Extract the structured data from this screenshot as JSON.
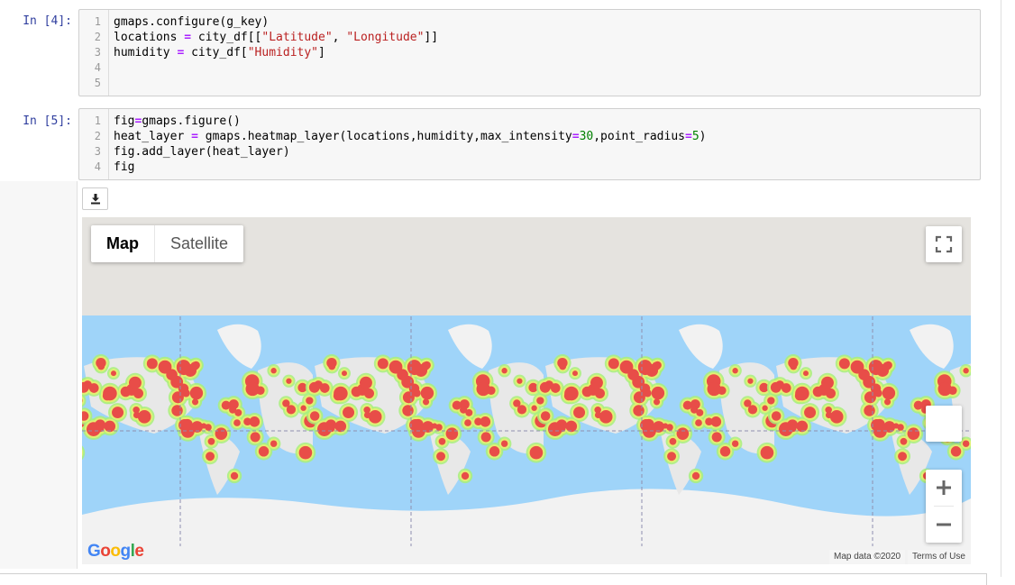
{
  "cells": [
    {
      "prompt": "In [4]:",
      "lines": [
        {
          "n": "1",
          "parts": [
            [
              "gmaps.configure(g_key)",
              ""
            ]
          ]
        },
        {
          "n": "2",
          "parts": [
            [
              "locations ",
              ""
            ],
            [
              "=",
              "op"
            ],
            [
              " city_df[[",
              ""
            ],
            [
              "\"Latitude\"",
              "str"
            ],
            [
              ", ",
              ""
            ],
            [
              "\"Longitude\"",
              "str"
            ],
            [
              "]]",
              ""
            ]
          ]
        },
        {
          "n": "3",
          "parts": [
            [
              "humidity ",
              ""
            ],
            [
              "=",
              "op"
            ],
            [
              " city_df[",
              ""
            ],
            [
              "\"Humidity\"",
              "str"
            ],
            [
              "]",
              ""
            ]
          ]
        },
        {
          "n": "4",
          "parts": []
        },
        {
          "n": "5",
          "parts": []
        }
      ]
    },
    {
      "prompt": "In [5]:",
      "lines": [
        {
          "n": "1",
          "parts": [
            [
              "fig",
              ""
            ],
            [
              "=",
              "op"
            ],
            [
              "gmaps.figure()",
              ""
            ]
          ]
        },
        {
          "n": "2",
          "parts": [
            [
              "heat_layer ",
              ""
            ],
            [
              "=",
              "op"
            ],
            [
              " gmaps.heatmap_layer(locations,humidity,max_intensity",
              ""
            ],
            [
              "=",
              "op"
            ],
            [
              "30",
              "num"
            ],
            [
              ",point_radius",
              ""
            ],
            [
              "=",
              "op"
            ],
            [
              "5",
              "num"
            ],
            [
              ")",
              ""
            ]
          ]
        },
        {
          "n": "3",
          "parts": [
            [
              "fig.add_layer(heat_layer)",
              ""
            ]
          ]
        },
        {
          "n": "4",
          "parts": [
            [
              "fig",
              ""
            ]
          ]
        }
      ]
    }
  ],
  "map": {
    "map_type_buttons": {
      "map": "Map",
      "satellite": "Satellite"
    },
    "attribution": {
      "data": "Map data ©2020",
      "terms": "Terms of Use"
    },
    "logo": {
      "letters": [
        "G",
        "o",
        "o",
        "g",
        "l",
        "e"
      ],
      "colors": [
        "#4285F4",
        "#EA4335",
        "#FBBC05",
        "#4285F4",
        "#34A853",
        "#EA4335"
      ]
    },
    "icons": {
      "download": "download-icon",
      "fullscreen": "fullscreen-icon",
      "zoom_in": "plus-icon",
      "zoom_out": "minus-icon"
    },
    "colors": {
      "ocean": "#9fd4f9",
      "land": "#e8e8e8",
      "polar": "#f2f2f2",
      "heat_outer": "#a8f07a",
      "heat_mid": "#e8f070",
      "heat_core": "#e84d48"
    }
  }
}
